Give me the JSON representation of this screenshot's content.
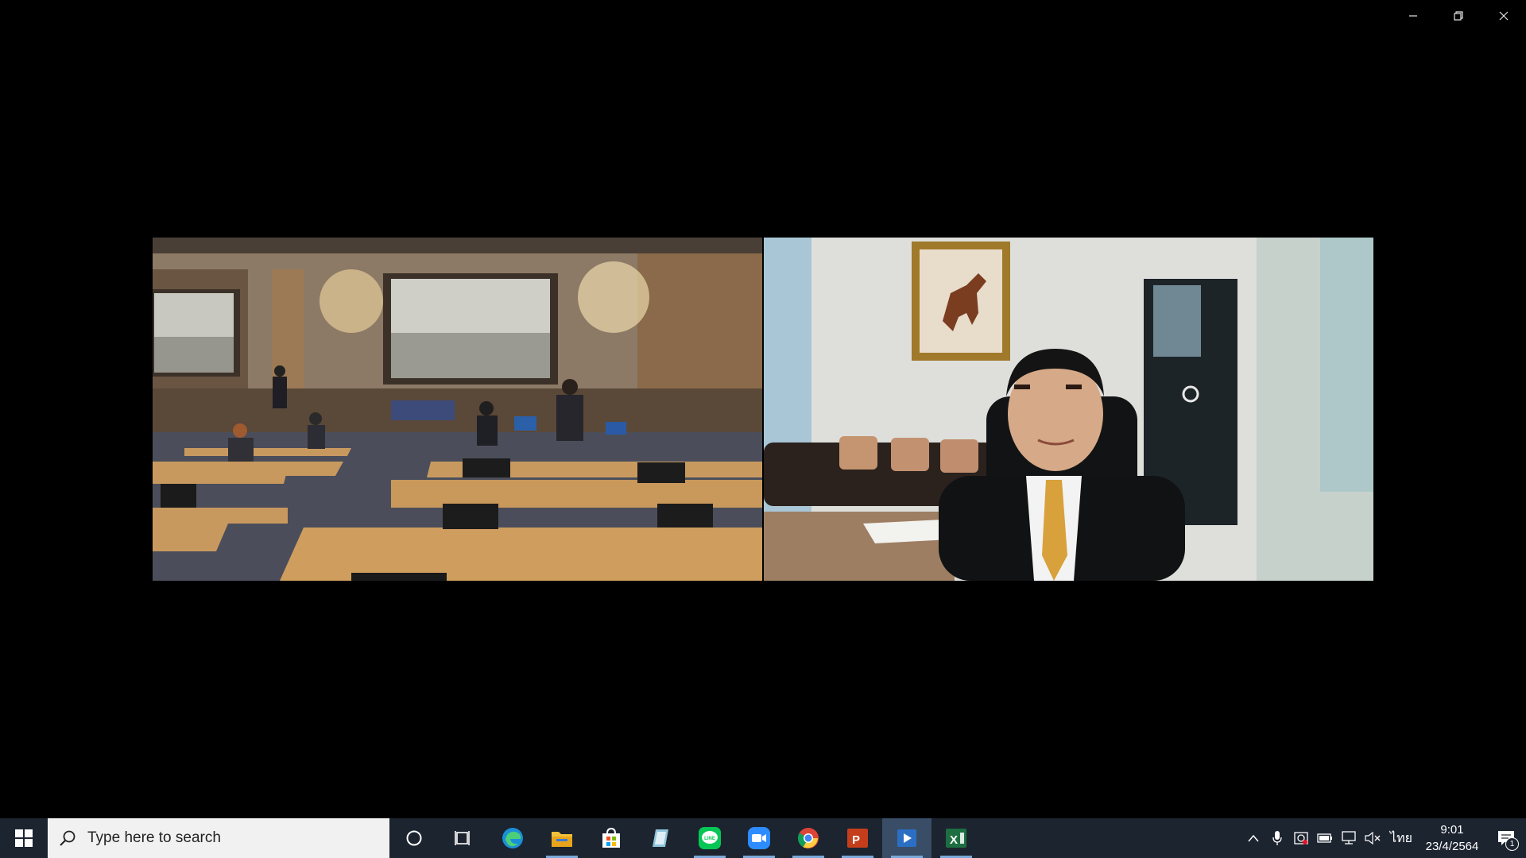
{
  "window": {
    "minimize_icon": "minimize-icon",
    "restore_icon": "restore-icon",
    "close_icon": "close-icon"
  },
  "video": {
    "left_tile": "conference-room-video",
    "right_tile": "office-participant-video"
  },
  "taskbar": {
    "search_placeholder": "Type here to search",
    "apps": [
      {
        "name": "cortana",
        "icon": "circle-icon"
      },
      {
        "name": "task-view",
        "icon": "task-view-icon"
      },
      {
        "name": "edge",
        "icon": "edge-icon"
      },
      {
        "name": "file-explorer",
        "icon": "folder-icon"
      },
      {
        "name": "store",
        "icon": "store-icon"
      },
      {
        "name": "notes",
        "icon": "notes-icon"
      },
      {
        "name": "line",
        "icon": "line-icon",
        "label": "LINE"
      },
      {
        "name": "zoom",
        "icon": "zoom-icon"
      },
      {
        "name": "chrome",
        "icon": "chrome-icon"
      },
      {
        "name": "powerpoint",
        "icon": "powerpoint-icon",
        "label": "P"
      },
      {
        "name": "media-player",
        "icon": "media-player-icon"
      },
      {
        "name": "excel",
        "icon": "excel-icon",
        "label": "X"
      }
    ],
    "tray": {
      "language": "ไทย",
      "time": "9:01",
      "date": "23/4/2564",
      "notification_count": "1"
    }
  },
  "colors": {
    "taskbar_bg": "#1c2430",
    "active_indicator": "#78a9d8"
  }
}
